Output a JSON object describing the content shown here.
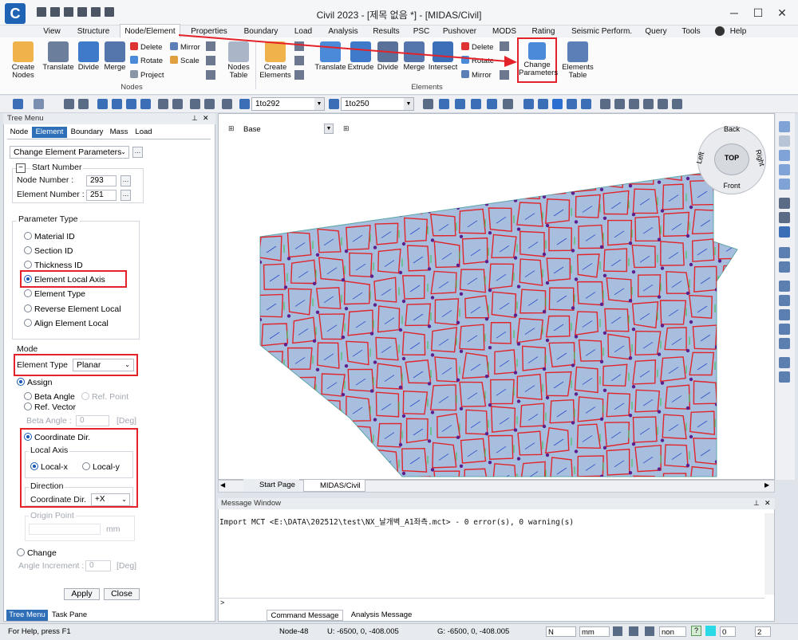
{
  "app": {
    "title": "Civil 2023 - [제목 없음 *] - [MIDAS/Civil]",
    "logo": "C"
  },
  "menu": {
    "tabs": [
      "View",
      "Structure",
      "Node/Element",
      "Properties",
      "Boundary",
      "Load",
      "Analysis",
      "Results",
      "PSC",
      "Pushover",
      "MODS",
      "Rating",
      "Seismic Perform.",
      "Query",
      "Tools"
    ],
    "help": "Help"
  },
  "ribbon": {
    "create_nodes": "Create\nNodes",
    "translate": "Translate",
    "divide": "Divide",
    "merge": "Merge",
    "delete": "Delete",
    "rotate": "Rotate",
    "project": "Project",
    "mirror": "Mirror",
    "scale": "Scale",
    "nodes_table": "Nodes\nTable",
    "create_elements": "Create\nElements",
    "e_translate": "Translate",
    "extrude": "Extrude",
    "e_divide": "Divide",
    "e_merge": "Merge",
    "intersect": "Intersect",
    "e_delete": "Delete",
    "e_rotate": "Rotate",
    "e_mirror": "Mirror",
    "change_parameters": "Change\nParameters",
    "elements_table": "Elements\nTable",
    "group_nodes": "Nodes",
    "group_elements": "Elements"
  },
  "toolbar": {
    "node_select": "1to292",
    "elem_select": "1to250"
  },
  "tree": {
    "title": "Tree Menu",
    "tabs": [
      "Node",
      "Element",
      "Boundary",
      "Mass",
      "Load"
    ],
    "function": "Change Element Parameters",
    "start_number": "Start Number",
    "node_number_label": "Node Number :",
    "node_number": "293",
    "element_number_label": "Element Number :",
    "element_number": "251",
    "parameter_type": "Parameter Type",
    "param_options": [
      "Material ID",
      "Section ID",
      "Thickness ID",
      "Element Local Axis",
      "Element Type",
      "Reverse Element Local",
      "Align Element Local"
    ],
    "mode": "Mode",
    "element_type_label": "Element Type",
    "element_type": "Planar",
    "assign": "Assign",
    "beta_angle_opt": "Beta Angle",
    "ref_point": "Ref. Point",
    "ref_vector": "Ref. Vector",
    "beta_angle_label": "Beta Angle :",
    "beta_angle_value": "0",
    "deg": "[Deg]",
    "coordinate_dir": "Coordinate Dir.",
    "local_axis": "Local Axis",
    "local_x": "Local-x",
    "local_y": "Local-y",
    "direction": "Direction",
    "coord_dir_label": "Coordinate Dir.",
    "coord_dir_value": "+X",
    "origin_point": "Origin Point",
    "mm": "mm",
    "change": "Change",
    "angle_increment": "Angle Increment :",
    "angle_value": "0",
    "deg2": "[Deg]",
    "apply": "Apply",
    "close": "Close"
  },
  "bottom_tabs": {
    "tree_menu": "Tree Menu",
    "task_pane": "Task Pane"
  },
  "viewport": {
    "view_label": "Base",
    "cube": {
      "top": "TOP",
      "back": "Back",
      "front": "Front",
      "left": "Left",
      "right": "Right"
    }
  },
  "doc_tabs": {
    "start_page": "Start Page",
    "midas": "MIDAS/Civil"
  },
  "message": {
    "title": "Message Window",
    "line": "Import MCT <E:\\DATA\\202512\\test\\NX_날개벽_A1좌측.mct> - 0 error(s), 0 warning(s)",
    "tab_command": "Command Message",
    "tab_analysis": "Analysis Message"
  },
  "status": {
    "help": "For Help, press F1",
    "node": "Node-48",
    "u": "U: -6500, 0, -408.005",
    "g": "G: -6500, 0, -408.005",
    "force_unit": "N",
    "length_unit": "mm",
    "non": "non",
    "num1": "0",
    "num2": "2"
  }
}
